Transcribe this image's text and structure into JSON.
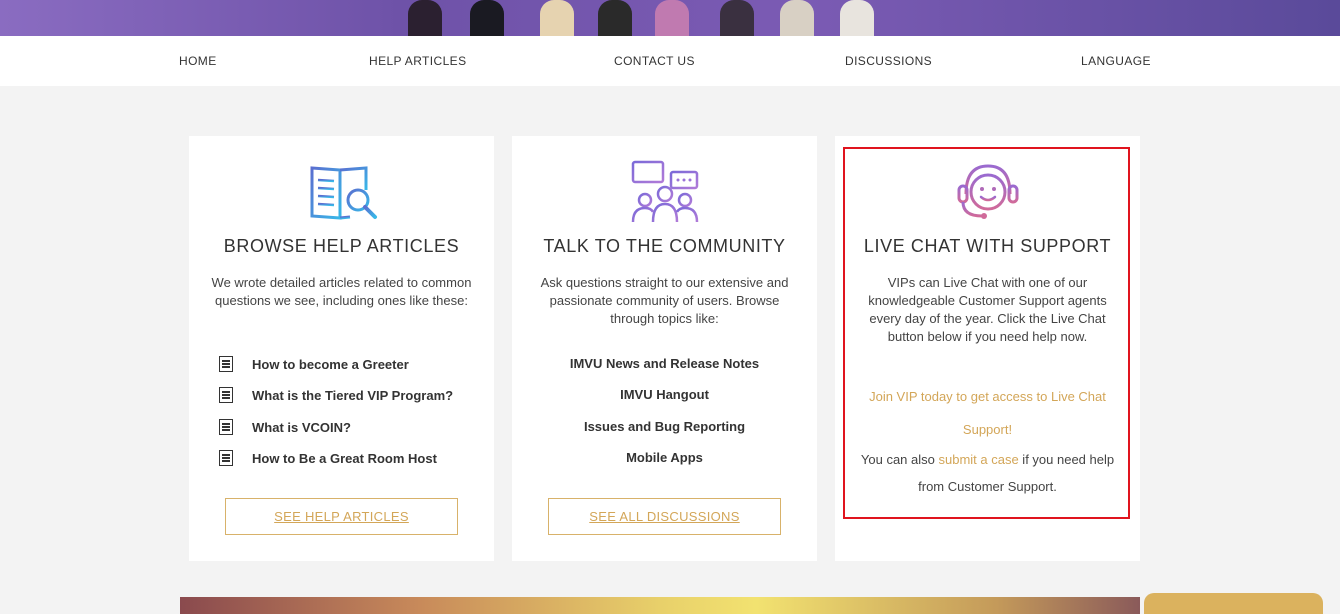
{
  "colors": {
    "accent_gold": "#d3a658",
    "highlight_red": "#e0141e",
    "nav_bg": "#ffffff",
    "page_bg": "#f3f3f3"
  },
  "nav": {
    "items": [
      {
        "label": "HOME"
      },
      {
        "label": "HELP ARTICLES"
      },
      {
        "label": "CONTACT US"
      },
      {
        "label": "DISCUSSIONS"
      },
      {
        "label": "LANGUAGE"
      }
    ]
  },
  "cards": {
    "help": {
      "icon": "book-search-icon",
      "title": "BROWSE HELP ARTICLES",
      "description": "We wrote detailed articles related to common questions we see, including ones like these:",
      "links": [
        {
          "icon": "document-icon",
          "label": "How to become a Greeter"
        },
        {
          "icon": "document-icon",
          "label": "What is the Tiered VIP Program?"
        },
        {
          "icon": "document-icon",
          "label": "What is VCOIN?"
        },
        {
          "icon": "document-icon",
          "label": "How to Be a Great Room Host"
        }
      ],
      "button": "SEE HELP ARTICLES"
    },
    "community": {
      "icon": "community-chat-icon",
      "title": "TALK TO THE COMMUNITY",
      "description": "Ask questions straight to our extensive and passionate community of users. Browse through topics like:",
      "links": [
        {
          "label": "IMVU News and Release Notes"
        },
        {
          "label": "IMVU Hangout"
        },
        {
          "label": "Issues and Bug Reporting"
        },
        {
          "label": "Mobile Apps"
        }
      ],
      "button": "SEE ALL DISCUSSIONS"
    },
    "live_chat": {
      "icon": "headset-support-icon",
      "title": "LIVE CHAT WITH SUPPORT",
      "description": "VIPs can Live Chat with one of our knowledgeable Customer Support agents every day of the year. Click the Live Chat button below if you need help now.",
      "vip_link": "Join VIP today to get access to Live Chat Support!",
      "also_prefix": "You can also ",
      "also_link": "submit a case",
      "also_suffix": " if you need help from Customer Support."
    }
  }
}
